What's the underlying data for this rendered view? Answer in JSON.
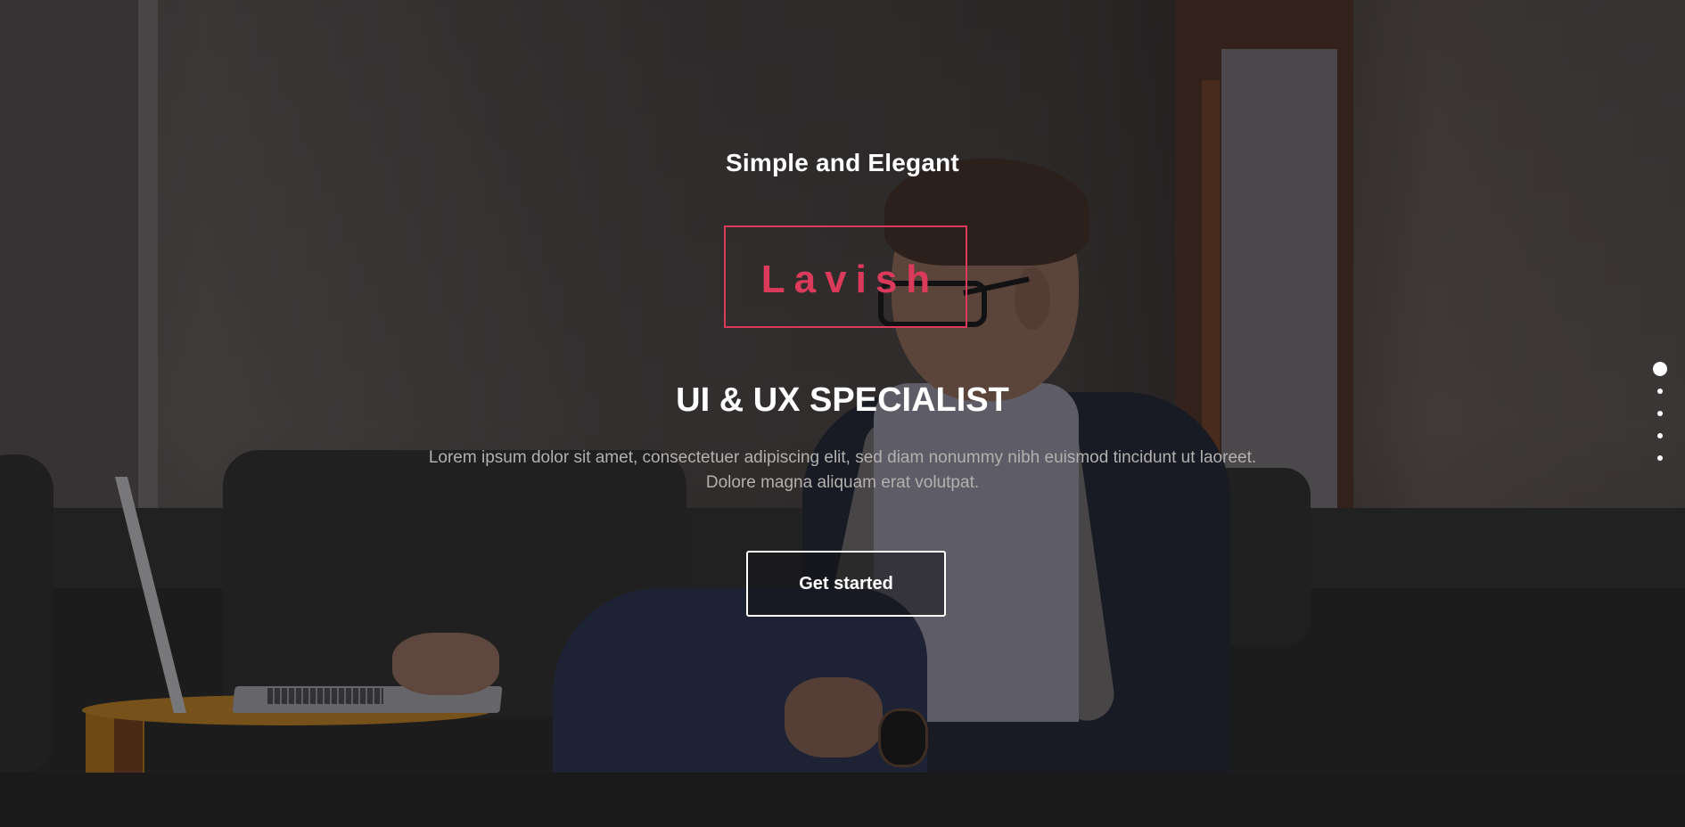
{
  "hero": {
    "tagline": "Simple and Elegant",
    "logo_text": "Lavish",
    "headline": "UI & UX SPECIALIST",
    "description": "Lorem ipsum dolor sit amet, consectetuer adipiscing elit, sed diam nonummy nibh euismod tincidunt ut laoreet. Dolore magna aliquam erat volutpat.",
    "cta_label": "Get started"
  },
  "slider": {
    "slide_count": 5,
    "active_index": 0
  },
  "colors": {
    "accent": "#dc3a5a",
    "text_primary": "#ffffff",
    "text_muted": "#b3b0ae",
    "footer_bg": "#1a1a1a"
  }
}
